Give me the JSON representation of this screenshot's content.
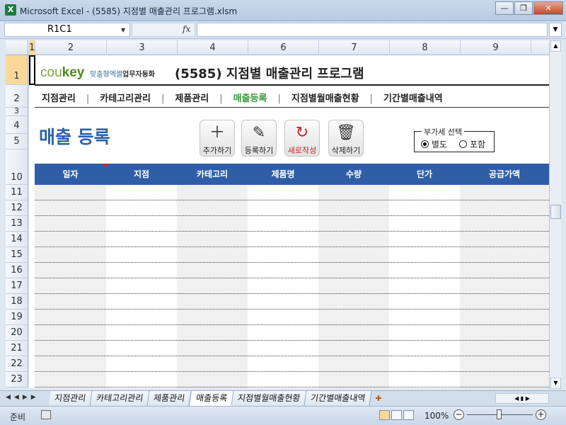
{
  "window": {
    "title": "Microsoft Excel - (5585) 지점별 매출관리 프로그램.xlsm",
    "icon": "excel-icon",
    "minimize": "—",
    "restore": "❐",
    "close": "✕"
  },
  "formula_bar": {
    "name_box": "R1C1",
    "fx": "fx",
    "formula": ""
  },
  "columns": [
    "1",
    "2",
    "3",
    "4",
    "6",
    "7",
    "8",
    "9"
  ],
  "rows": [
    "1",
    "2",
    "3",
    "4",
    "5",
    "10",
    "11",
    "12",
    "13",
    "14",
    "15",
    "16",
    "17",
    "18",
    "19",
    "20",
    "21",
    "22",
    "23"
  ],
  "brand": {
    "logo_co": "cou",
    "logo_key": "key",
    "tagline_a": "맞춤형엑셀",
    "tagline_b": "업무자동화",
    "program_title": "(5585) 지점별 매출관리 프로그램"
  },
  "nav": {
    "items": [
      "지점관리",
      "카테고리관리",
      "제품관리",
      "매출등록",
      "지점별월매출현황",
      "기간별매출내역"
    ],
    "separator": "|",
    "active": "매출등록"
  },
  "page_title": "매출 등록",
  "toolbar": {
    "add": {
      "icon": "plus-icon",
      "label": "추가하기"
    },
    "register": {
      "icon": "pencil-icon",
      "label": "등록하기"
    },
    "new": {
      "icon": "refresh-icon",
      "label": "새로작성"
    },
    "delete": {
      "icon": "trash-icon",
      "label": "삭제하기"
    }
  },
  "vat": {
    "legend": "부가세 선택",
    "options": [
      "별도",
      "포함"
    ],
    "selected": "별도"
  },
  "table": {
    "headers": [
      "일자",
      "지점",
      "카테고리",
      "제품명",
      "수량",
      "단가",
      "공급가액"
    ],
    "rows": 13
  },
  "sheet_tabs": [
    "지점관리",
    "카테고리관리",
    "제품관리",
    "매출등록",
    "지점별월매출현황",
    "기간별매출내역"
  ],
  "active_tab": "매출등록",
  "status": {
    "ready": "준비",
    "zoom": "100%"
  },
  "colors": {
    "header_blue": "#2f5ea6",
    "title_blue": "#2b62ad",
    "active_nav_green": "#3a9a3a",
    "new_button_red": "#c0232a"
  }
}
